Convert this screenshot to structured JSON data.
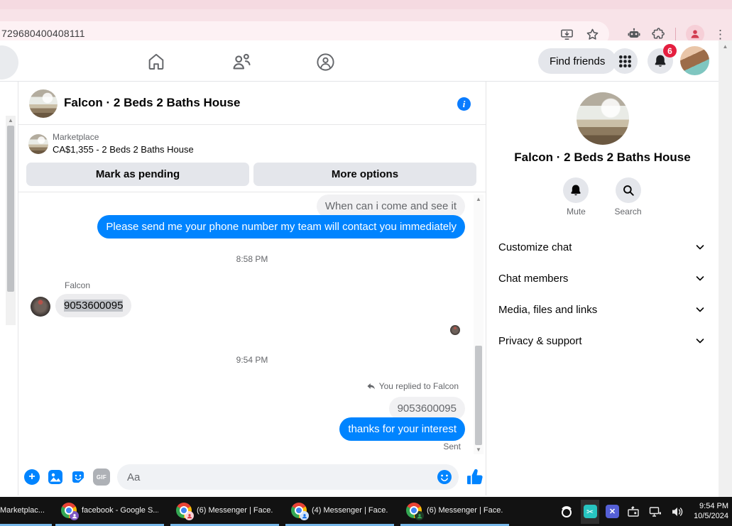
{
  "browser": {
    "url_text": "729680400408111"
  },
  "fb_nav": {
    "find_friends": "Find friends",
    "notification_count": "6"
  },
  "chat": {
    "title": "Falcon · 2 Beds 2 Baths House",
    "marketplace": {
      "label": "Marketplace",
      "listing": "CA$1,355 - 2 Beds 2 Baths House",
      "mark_pending": "Mark as pending",
      "more_options": "More options"
    },
    "messages": {
      "reply_context_1": "When can i come and see it",
      "outgoing_1": "Please send me your phone number my team will contact you immediately",
      "timestamp_1": "8:58 PM",
      "sender_name": "Falcon",
      "incoming_1": "9053600095",
      "timestamp_2": "9:54 PM",
      "reply_label": "You replied to Falcon",
      "reply_context_2": "9053600095",
      "outgoing_2": "thanks for your interest",
      "status": "Sent"
    },
    "composer": {
      "placeholder": "Aa",
      "gif_label": "GIF"
    }
  },
  "sidebar": {
    "title": "Falcon · 2 Beds 2 Baths House",
    "mute_label": "Mute",
    "search_label": "Search",
    "menu": [
      {
        "label": "Customize chat"
      },
      {
        "label": "Chat members"
      },
      {
        "label": "Media, files and links"
      },
      {
        "label": "Privacy & support"
      }
    ]
  },
  "taskbar": {
    "items": [
      {
        "label": "Marketplac..."
      },
      {
        "label": "facebook - Google S..."
      },
      {
        "label": "(6) Messenger | Face..."
      },
      {
        "label": "(4) Messenger | Face..."
      },
      {
        "label": "(6) Messenger | Face..."
      }
    ],
    "clock": {
      "time": "9:54 PM",
      "date": "10/5/2024"
    }
  },
  "colors": {
    "messenger_blue": "#0084ff",
    "notification_red": "#e41e3f",
    "taskbar_underline": "#75b6e8"
  }
}
